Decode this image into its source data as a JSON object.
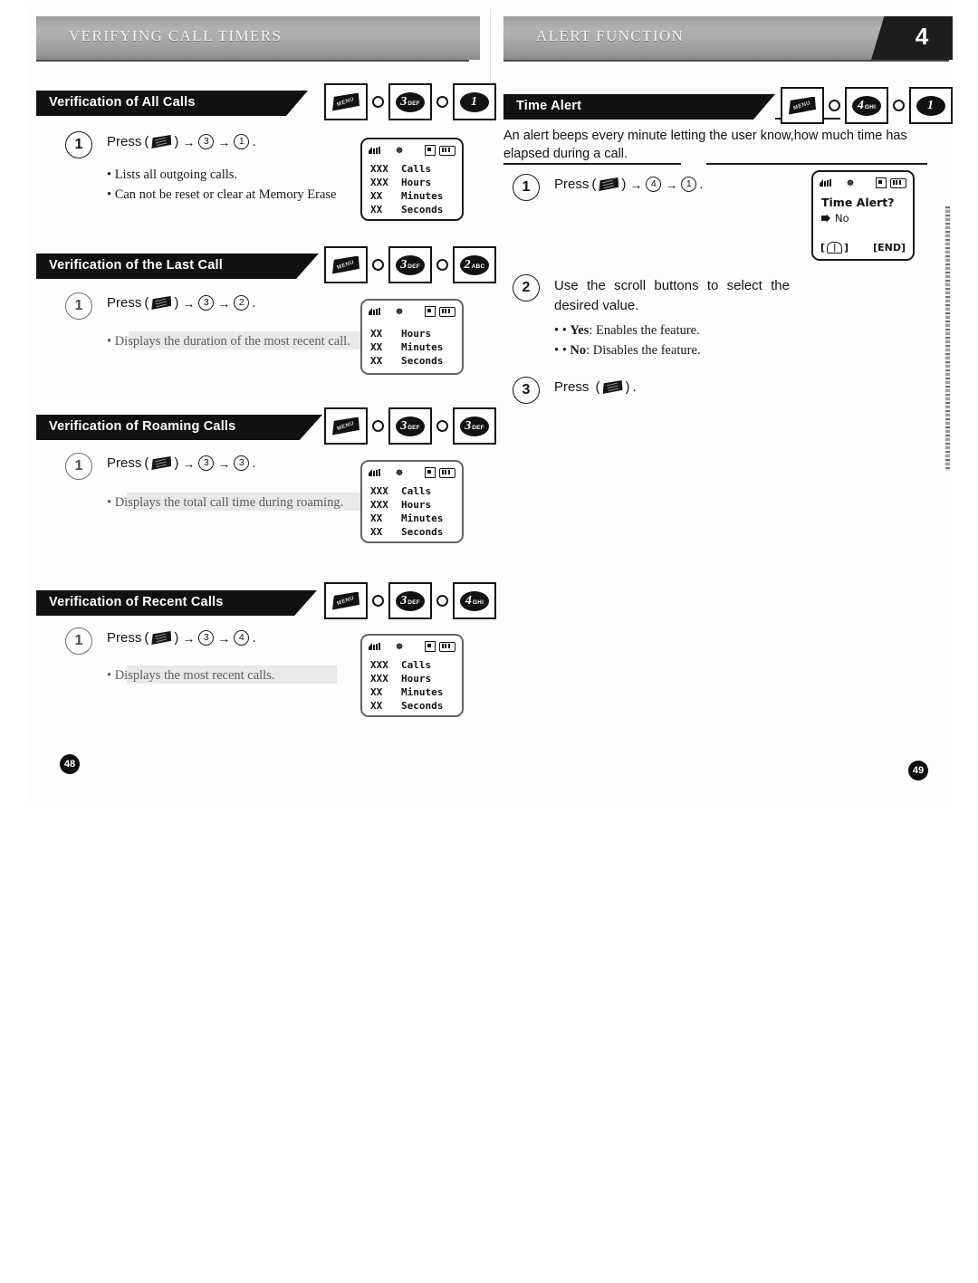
{
  "spread": {
    "left_page": {
      "running_head": "VERIFYING CALL TIMERS",
      "page_number": "48",
      "sections": [
        {
          "banner": "Verification of All Calls",
          "keys": [
            {
              "type": "menu",
              "label": "MENU"
            },
            {
              "type": "sep"
            },
            {
              "type": "num",
              "digit": "3",
              "letters": "DEF"
            },
            {
              "type": "sep"
            },
            {
              "type": "num",
              "digit": "1",
              "letters": ""
            }
          ],
          "step": {
            "number": "1",
            "press_label": "Press",
            "key_icon": "menu-key-icon",
            "sequence": [
              "3",
              "1"
            ]
          },
          "bullets": [
            "Lists all outgoing calls.",
            "Can not be reset or clear at Memory Erase"
          ],
          "display": {
            "status": [
              "signal-icon",
              "roaming-icon",
              "message-icon",
              "battery-icon"
            ],
            "rows": [
              {
                "value": "XXX",
                "label": "Calls"
              },
              {
                "value": "XXX",
                "label": "Hours"
              },
              {
                "value": "XX",
                "label": "Minutes"
              },
              {
                "value": "XX",
                "label": "Seconds"
              }
            ]
          }
        },
        {
          "banner": "Verification of the Last Call",
          "keys": [
            {
              "type": "menu",
              "label": "MENU"
            },
            {
              "type": "sep"
            },
            {
              "type": "num",
              "digit": "3",
              "letters": "DEF"
            },
            {
              "type": "sep"
            },
            {
              "type": "num",
              "digit": "2",
              "letters": "ABC"
            }
          ],
          "step": {
            "number": "1",
            "press_label": "Press",
            "key_icon": "menu-key-icon",
            "sequence": [
              "3",
              "2"
            ]
          },
          "bullets": [
            "Displays the duration of the most recent call."
          ],
          "display": {
            "status": [
              "signal-icon",
              "roaming-icon",
              "message-icon",
              "battery-icon"
            ],
            "rows": [
              {
                "value": "XX",
                "label": "Hours"
              },
              {
                "value": "XX",
                "label": "Minutes"
              },
              {
                "value": "XX",
                "label": "Seconds"
              }
            ]
          }
        },
        {
          "banner": "Verification of Roaming Calls",
          "keys": [
            {
              "type": "menu",
              "label": "MENU"
            },
            {
              "type": "sep"
            },
            {
              "type": "num",
              "digit": "3",
              "letters": "DEF"
            },
            {
              "type": "sep"
            },
            {
              "type": "num",
              "digit": "3",
              "letters": "DEF"
            }
          ],
          "step": {
            "number": "1",
            "press_label": "Press",
            "key_icon": "menu-key-icon",
            "sequence": [
              "3",
              "3"
            ]
          },
          "bullets": [
            "Displays the total call time during roaming."
          ],
          "display": {
            "status": [
              "signal-icon",
              "roaming-icon",
              "message-icon",
              "battery-icon"
            ],
            "rows": [
              {
                "value": "XXX",
                "label": "Calls"
              },
              {
                "value": "XXX",
                "label": "Hours"
              },
              {
                "value": "XX",
                "label": "Minutes"
              },
              {
                "value": "XX",
                "label": "Seconds"
              }
            ]
          }
        },
        {
          "banner": "Verification of Recent Calls",
          "keys": [
            {
              "type": "menu",
              "label": "MENU"
            },
            {
              "type": "sep"
            },
            {
              "type": "num",
              "digit": "3",
              "letters": "DEF"
            },
            {
              "type": "sep"
            },
            {
              "type": "num",
              "digit": "4",
              "letters": "GHI"
            }
          ],
          "step": {
            "number": "1",
            "press_label": "Press",
            "key_icon": "menu-key-icon",
            "sequence": [
              "3",
              "4"
            ]
          },
          "bullets": [
            "Displays the most recent calls."
          ],
          "display": {
            "status": [
              "signal-icon",
              "roaming-icon",
              "message-icon",
              "battery-icon"
            ],
            "rows": [
              {
                "value": "XXX",
                "label": "Calls"
              },
              {
                "value": "XXX",
                "label": "Hours"
              },
              {
                "value": "XX",
                "label": "Minutes"
              },
              {
                "value": "XX",
                "label": "Seconds"
              }
            ]
          }
        }
      ]
    },
    "right_page": {
      "running_head": "ALERT FUNCTION",
      "chapter_number": "4",
      "page_number": "49",
      "section": {
        "banner": "Time Alert",
        "keys": [
          {
            "type": "menu",
            "label": "MENU"
          },
          {
            "type": "sep"
          },
          {
            "type": "num",
            "digit": "4",
            "letters": "GHI"
          },
          {
            "type": "sep"
          },
          {
            "type": "num",
            "digit": "1",
            "letters": ""
          }
        ],
        "intro": "An alert beeps every minute letting the user know,how much time has elapsed during a call.",
        "steps": [
          {
            "number": "1",
            "press_label": "Press",
            "key_icon": "menu-key-icon",
            "sequence": [
              "4",
              "1"
            ]
          },
          {
            "number": "2",
            "text": "Use the scroll buttons to select the desired value.",
            "bullets": [
              {
                "term": "Yes",
                "desc": ": Enables the feature."
              },
              {
                "term": "No",
                "desc": ": Disables the feature."
              }
            ]
          },
          {
            "number": "3",
            "press_label": "Press",
            "key_icon": "ok-key-icon"
          }
        ],
        "display": {
          "status": [
            "signal-icon",
            "roaming-icon",
            "message-icon",
            "battery-icon"
          ],
          "title": "Time Alert?",
          "selected": "No",
          "softkey_left": "phonebook-icon",
          "softkey_right": "[END]"
        }
      }
    }
  }
}
